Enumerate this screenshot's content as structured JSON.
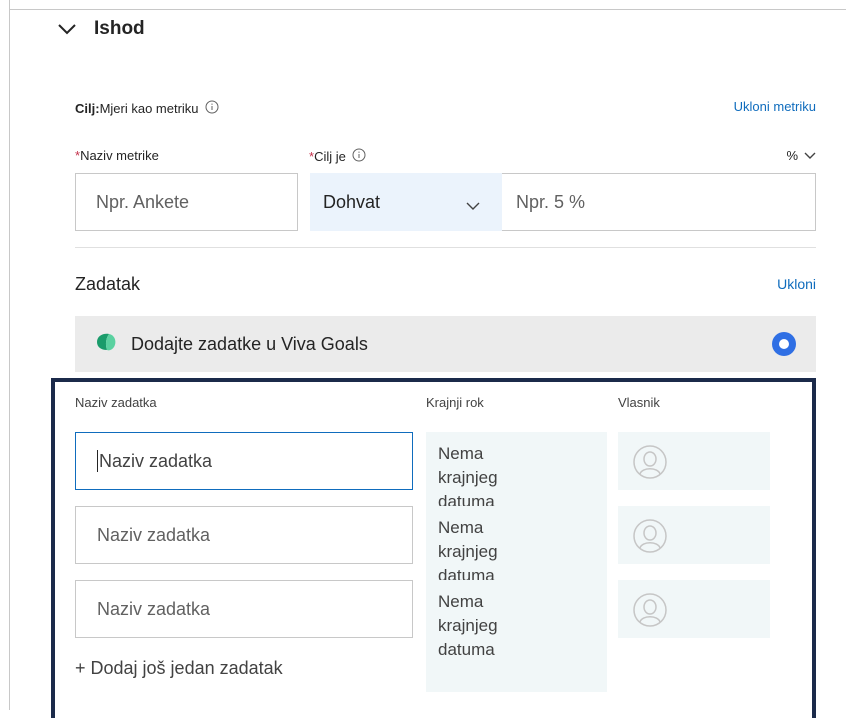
{
  "section": {
    "title": "Ishod",
    "expanded_icon": "chevron-down-icon"
  },
  "goal": {
    "prefix": "Cilj:",
    "text": "Mjeri kao metriku",
    "remove_link": "Ukloni metriku"
  },
  "metric": {
    "required_mark": "*",
    "name_label": "Naziv metrike",
    "target_label": "Cilj je",
    "unit_label": "%",
    "name_placeholder": "Npr. Ankete",
    "target_type": "Dohvat",
    "target_placeholder": "Npr. 5 %"
  },
  "tasks": {
    "title": "Zadatak",
    "remove_link": "Ukloni",
    "viva_text": "Dodajte zadatke u Viva Goals",
    "columns": {
      "name": "Naziv zadatka",
      "deadline": "Krajnji rok",
      "owner": "Vlasnik"
    },
    "rows": [
      {
        "placeholder": "Naziv zadatka",
        "deadline": [
          "Nema",
          "krajnjeg",
          "datuma"
        ]
      },
      {
        "placeholder": "Naziv zadatka",
        "deadline": [
          "Nema",
          "krajnjeg",
          "datuma"
        ]
      },
      {
        "placeholder": "Naziv zadatka",
        "deadline": [
          "Nema",
          "krajnjeg",
          "datuma"
        ]
      }
    ],
    "add_task": "+ Dodaj još jedan zadatak"
  },
  "colors": {
    "accent": "#0f6cbd",
    "panel_border": "#1b2a4a",
    "required": "#c4314b"
  }
}
